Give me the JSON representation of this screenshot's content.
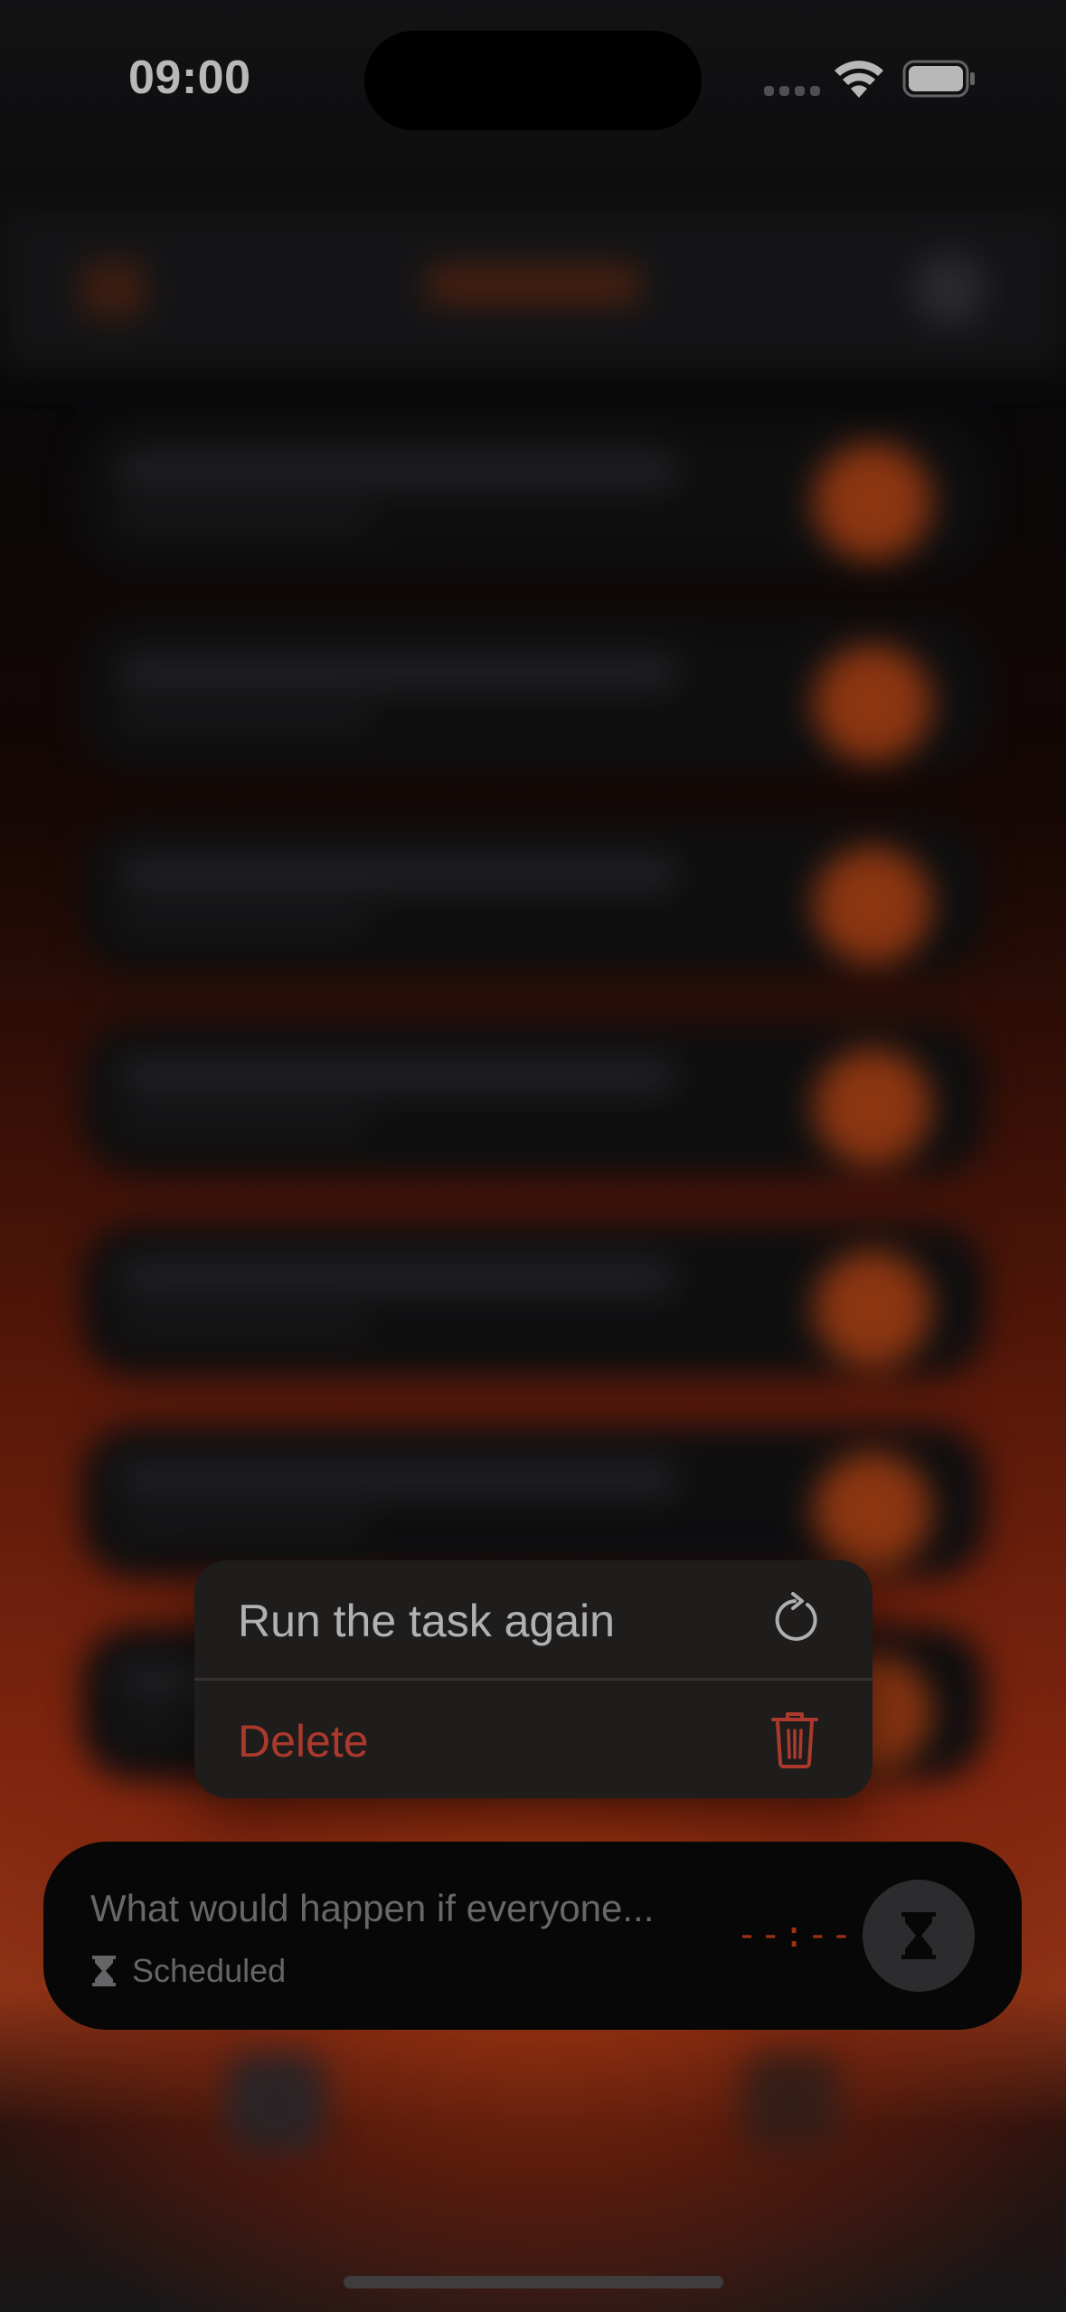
{
  "status_bar": {
    "time": "09:00"
  },
  "context_menu": {
    "items": [
      {
        "label": "Run the task again",
        "icon": "refresh-icon"
      },
      {
        "label": "Delete",
        "icon": "trash-icon",
        "color": "#ee4f3d"
      }
    ]
  },
  "task_card": {
    "title": "What would happen if everyone...",
    "status": "Scheduled",
    "status_icon": "hourglass-icon",
    "timer": "--:--",
    "action_icon": "hourglass-icon"
  },
  "colors": {
    "accent": "#d8441f",
    "destructive": "#ee4f3d",
    "menu_background": "#2c2828",
    "card_background": "#0a0a0a"
  }
}
